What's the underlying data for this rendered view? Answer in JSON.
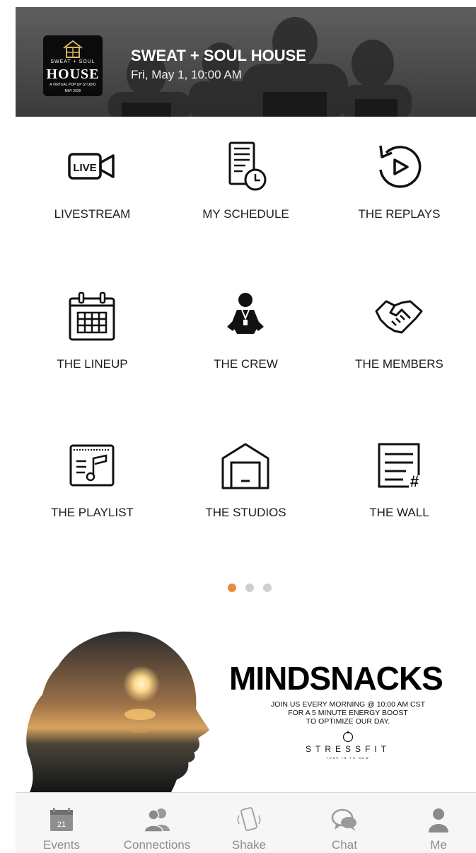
{
  "header": {
    "logo": {
      "line1": "SWEAT + SOUL",
      "line2": "HOUSE",
      "line3": "A VIRTUAL POP UP STUDIO",
      "line4": "MAY 2020"
    },
    "title": "SWEAT + SOUL HOUSE",
    "datetime": "Fri, May 1, 10:00 AM"
  },
  "grid": {
    "items": [
      {
        "label": "LIVESTREAM",
        "icon": "live-video-icon"
      },
      {
        "label": "MY SCHEDULE",
        "icon": "schedule-clock-icon"
      },
      {
        "label": "THE REPLAYS",
        "icon": "replay-icon"
      },
      {
        "label": "THE LINEUP",
        "icon": "calendar-icon"
      },
      {
        "label": "THE CREW",
        "icon": "crew-person-icon"
      },
      {
        "label": "THE MEMBERS",
        "icon": "handshake-icon"
      },
      {
        "label": "THE PLAYLIST",
        "icon": "playlist-music-icon"
      },
      {
        "label": "THE STUDIOS",
        "icon": "studio-garage-icon"
      },
      {
        "label": "THE WALL",
        "icon": "wall-hashtag-icon"
      }
    ]
  },
  "pager": {
    "count": 3,
    "active": 0,
    "active_color": "#ec8a3a",
    "inactive_color": "#cfcfcf"
  },
  "banner": {
    "title": "MINDSNACKS",
    "lines": [
      "JOIN US EVERY MORNING @ 10:00 AM CST",
      "FOR A 5 MINUTE ENERGY BOOST",
      "TO OPTIMIZE OUR DAY."
    ],
    "brand": "STRESSFIT",
    "tagline": "TUNE IN TO NOW"
  },
  "tabbar": {
    "tabs": [
      {
        "label": "Events",
        "icon": "calendar-21-icon",
        "badge": "21"
      },
      {
        "label": "Connections",
        "icon": "people-icon"
      },
      {
        "label": "Shake",
        "icon": "shake-phone-icon"
      },
      {
        "label": "Chat",
        "icon": "chat-bubbles-icon"
      },
      {
        "label": "Me",
        "icon": "person-icon"
      }
    ]
  }
}
